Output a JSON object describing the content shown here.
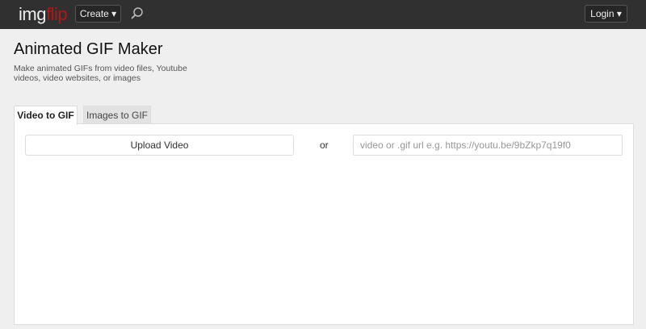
{
  "header": {
    "logo_part1": "img",
    "logo_part2": "flip",
    "create_label": "Create ▾",
    "login_label": "Login ▾"
  },
  "page": {
    "title": "Animated GIF Maker",
    "description": "Make animated GIFs from video files, Youtube videos, video websites, or images"
  },
  "tabs": [
    {
      "label": "Video to GIF"
    },
    {
      "label": "Images to GIF"
    }
  ],
  "panel": {
    "upload_label": "Upload Video",
    "or_label": "or",
    "url_placeholder": "video or .gif url e.g. https://youtu.be/9bZkp7q19f0"
  }
}
